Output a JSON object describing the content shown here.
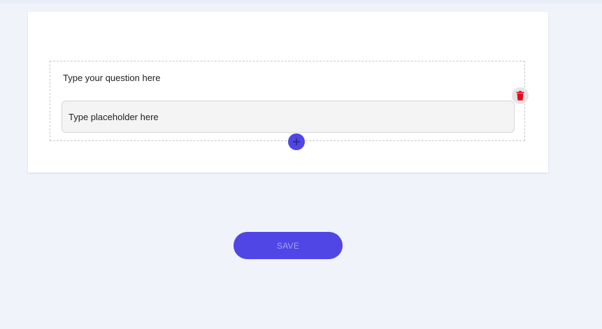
{
  "question": {
    "text": "Type your question here",
    "placeholder": "Type placeholder here"
  },
  "actions": {
    "delete_icon": "trash-icon",
    "add_icon": "plus-icon",
    "save_label": "SAVE"
  },
  "colors": {
    "background": "#f0f3f9",
    "accent": "#5046e5",
    "delete": "#e8091b",
    "card": "#ffffff"
  }
}
